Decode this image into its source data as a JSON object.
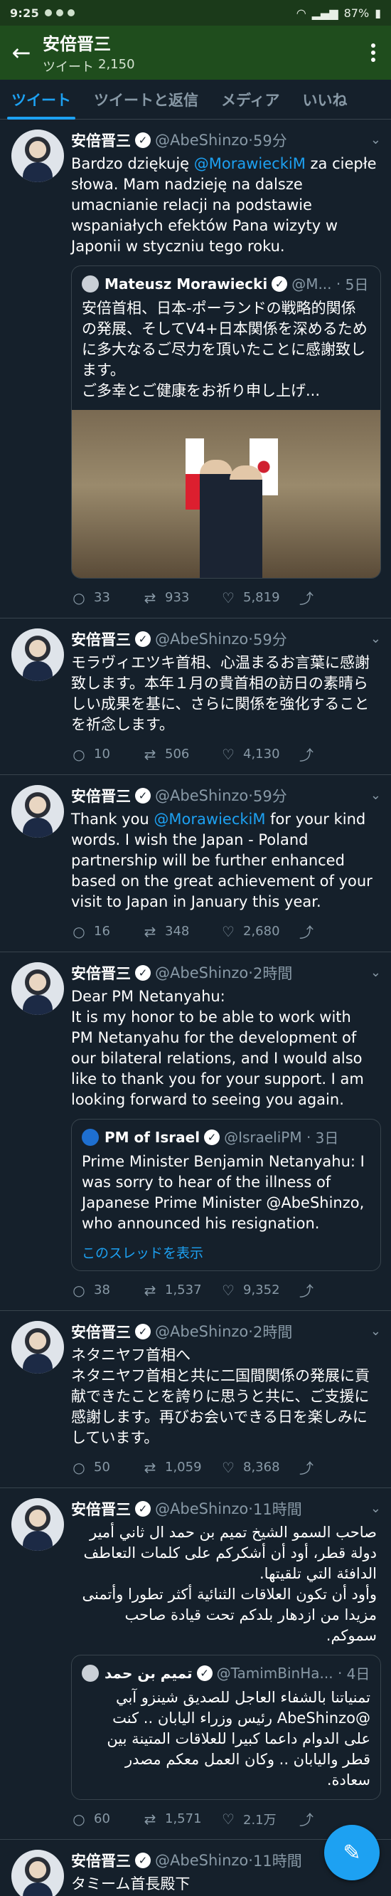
{
  "status_bar": {
    "time": "9:25",
    "battery": "87%"
  },
  "profile": {
    "name": "安倍晋三",
    "tweet_count_label": "ツイート",
    "tweet_count": "2,150"
  },
  "tabs": [
    "ツイート",
    "ツイートと返信",
    "メディア",
    "いいね"
  ],
  "tweets": [
    {
      "name": "安倍晋三",
      "handle": "@AbeShinzo",
      "time": "59分",
      "text_before": "Bardzo dziękuję ",
      "mention": "@MorawieckiM",
      "text_after": " za ciepłe słowa. Mam nadzieję na dalsze umacnianie relacji na podstawie wspaniałych efektów Pana wizyty w Japonii w styczniu tego roku.",
      "quote": {
        "name": "Mateusz Morawiecki",
        "handle": "@M...",
        "time": "5日",
        "text": "安倍首相、日本-ポーランドの戦略的関係の発展、そしてV4+日本関係を深めるために多大なるご尽力を頂いたことに感謝致します。\nご多幸とご健康をお祈り申し上げ..."
      },
      "replies": "33",
      "retweets": "933",
      "likes": "5,819"
    },
    {
      "name": "安倍晋三",
      "handle": "@AbeShinzo",
      "time": "59分",
      "text": "モラヴィエツキ首相、心温まるお言葉に感謝致します。本年１月の貴首相の訪日の素晴らしい成果を基に、さらに関係を強化することを祈念します。",
      "replies": "10",
      "retweets": "506",
      "likes": "4,130"
    },
    {
      "name": "安倍晋三",
      "handle": "@AbeShinzo",
      "time": "59分",
      "text_before": "Thank you ",
      "mention": "@MorawieckiM",
      "text_after": " for your kind words. I wish the Japan - Poland partnership will be further enhanced based on the great achievement of your visit to Japan in January this year.",
      "replies": "16",
      "retweets": "348",
      "likes": "2,680"
    },
    {
      "name": "安倍晋三",
      "handle": "@AbeShinzo",
      "time": "2時間",
      "text": "Dear PM Netanyahu:\nIt is my honor to be able to work with PM Netanyahu for the development of our bilateral relations, and I would also like to thank you for your support. I am looking forward to seeing you again.",
      "quote": {
        "name": "PM of Israel",
        "handle": "@IsraeliPM",
        "time": "3日",
        "text": "Prime Minister Benjamin Netanyahu: I was sorry to hear of the illness of Japanese Prime Minister @AbeShinzo, who announced his resignation.",
        "show_thread": "このスレッドを表示"
      },
      "replies": "38",
      "retweets": "1,537",
      "likes": "9,352"
    },
    {
      "name": "安倍晋三",
      "handle": "@AbeShinzo",
      "time": "2時間",
      "text": "ネタニヤフ首相へ\nネタニヤフ首相と共に二国間関係の発展に貢献できたことを誇りに思うと共に、ご支援に感謝します。再びお会いできる日を楽しみにしています。",
      "replies": "50",
      "retweets": "1,059",
      "likes": "8,368"
    },
    {
      "name": "安倍晋三",
      "handle": "@AbeShinzo",
      "time": "11時間",
      "text": "صاحب السمو الشيخ تميم بن حمد ال ثاني أمير دولة قطر، أود أن أشكركم على كلمات التعاطف الدافئة التي تلقيتها.\nوأود أن تكون العلاقات الثنائية أكثر تطورا وأتمنى مزيدا من ازدهار بلدكم تحت قيادة صاحب سموكم.",
      "quote": {
        "name": "تميم بن حمد",
        "handle": "@TamimBinHa...",
        "time": "4日",
        "text": "تمنياتنا بالشفاء العاجل للصديق شينزو آبي @AbeShinzo رئيس وزراء اليابان .. كنت على الدوام داعما كبيرا للعلاقات المتينة بين قطر واليابان .. وكان العمل معكم مصدر سعادة."
      },
      "replies": "60",
      "retweets": "1,571",
      "likes": "2.1万"
    },
    {
      "name": "安倍晋三",
      "handle": "@AbeShinzo",
      "time": "11時間",
      "text": "タミーム首長殿下\n心温まる御見舞いの言葉をいただき深く感謝"
    }
  ]
}
